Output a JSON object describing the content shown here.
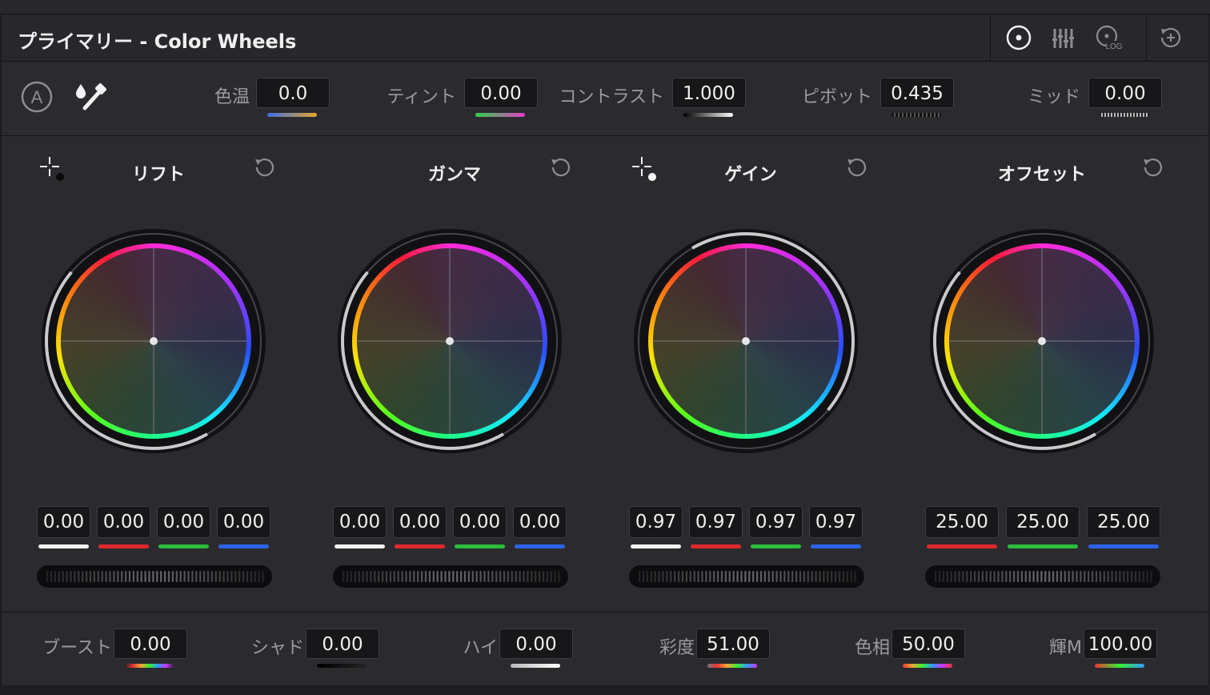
{
  "header": {
    "title": "プライマリー - Color Wheels",
    "icons": [
      "wheels-mode-icon",
      "bars-mode-icon",
      "log-mode-icon",
      "reset-all-icon"
    ],
    "log_label": "LOG"
  },
  "toolbar": {
    "auto_label": "A",
    "params": [
      {
        "label": "色温",
        "value": "0.0"
      },
      {
        "label": "ティント",
        "value": "0.00"
      },
      {
        "label": "コントラスト",
        "value": "1.000"
      },
      {
        "label": "ピボット",
        "value": "0.435"
      },
      {
        "label": "ミッド",
        "value": "0.00"
      }
    ]
  },
  "wheels": [
    {
      "name": "リフト",
      "values": [
        "0.00",
        "0.00",
        "0.00",
        "0.00"
      ]
    },
    {
      "name": "ガンマ",
      "values": [
        "0.00",
        "0.00",
        "0.00",
        "0.00"
      ]
    },
    {
      "name": "ゲイン",
      "values": [
        "0.97",
        "0.97",
        "0.97",
        "0.97"
      ]
    },
    {
      "name": "オフセット",
      "values": [
        "25.00",
        "25.00",
        "25.00"
      ]
    }
  ],
  "bottom": {
    "params": [
      {
        "label": "ブースト",
        "value": "0.00"
      },
      {
        "label": "シャド",
        "value": "0.00"
      },
      {
        "label": "ハイ",
        "value": "0.00"
      },
      {
        "label": "彩度",
        "value": "51.00"
      },
      {
        "label": "色相",
        "value": "50.00"
      },
      {
        "label": "輝M",
        "value": "100.00"
      }
    ]
  },
  "colors": {
    "white": "#f2f2f2",
    "red": "#e0282c",
    "green": "#2bbd3c",
    "blue": "#2c63e6",
    "panel": "#2b2b2f",
    "box": "#17171a"
  }
}
